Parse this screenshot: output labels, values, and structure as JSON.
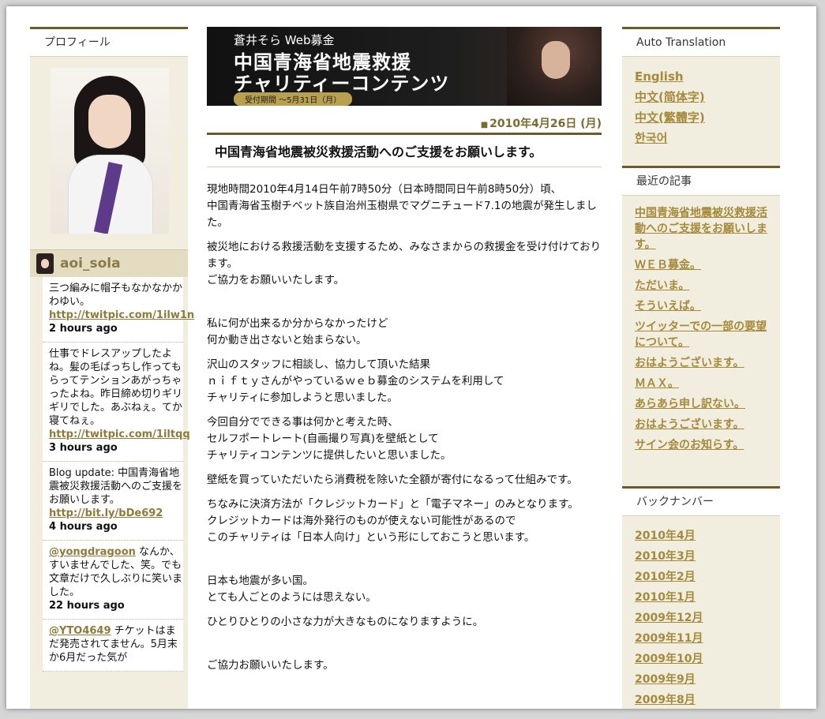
{
  "left_sidebar": {
    "profile_heading": "プロフィール",
    "twitter_username": "aoi_sola",
    "tweets": [
      {
        "text": "三つ編みに帽子もなかなかかわゆい。",
        "link": "http://twitpic.com/1ilw1n",
        "ago": "2 hours ago"
      },
      {
        "text": "仕事でドレスアップしたよね。髪の毛ばっちし作ってもらってテンションあがっちゃったよね。昨日締め切りギリギリでした。あぶねぇ。てか寝てねぇ。",
        "link": "http://twitpic.com/1iltqq",
        "ago": "3 hours ago"
      },
      {
        "text": "Blog update: 中国青海省地震被災救援活動へのご支援をお願いします。",
        "link": "http://bit.ly/bDe692",
        "ago": "4 hours ago"
      },
      {
        "mention": "@yongdragoon",
        "text": " なんか、すいませんでした、笑。でも文章だけで久しぶりに笑いました。",
        "ago": "22 hours ago"
      },
      {
        "mention": "@YTO4649",
        "text": " チケットはまだ発売されてません。5月末か6月だった気が"
      }
    ]
  },
  "banner": {
    "subtitle": "蒼井そら Web募金",
    "title_line1": "中国青海省地震救援",
    "title_line2": "チャリティーコンテンツ",
    "period": "受付期間 ～5月31日（月）"
  },
  "post": {
    "date": "2010年4月26日 (月)",
    "title": "中国青海省地震被災救援活動へのご支援をお願いします。",
    "paragraphs": [
      "現地時間2010年4月14日午前7時50分（日本時間同日午前8時50分）頃、\n中国青海省玉樹チベット族自治州玉樹県でマグニチュード7.1の地震が発生しました。",
      "被災地における救援活動を支援するため、みなさまからの救援金を受け付けております。\nご協力をお願いいたします。",
      "私に何が出来るか分からなかったけど\n何か動き出さないと始まらない。",
      "沢山のスタッフに相談し、協力して頂いた結果\nｎｉｆｔｙさんがやっているｗｅｂ募金のシステムを利用して\nチャリティに参加しようと思いました。",
      "今回自分でできる事は何かと考えた時、\nセルフポートレート(自画撮り写真)を壁紙として\nチャリティコンテンツに提供したいと思いました。",
      "壁紙を買っていただいたら消費税を除いた全額が寄付になるって仕組みです。",
      "ちなみに決済方法が「クレジットカード」と「電子マネー」のみとなります。\nクレジットカードは海外発行のものが使えない可能性があるので\nこのチャリティは「日本人向け」という形にしておこうと思います。",
      "日本も地震が多い国。\nとても人ごとのようには思えない。",
      "ひとりひとりの小さな力が大きなものになりますように。",
      "ご協力お願いいたします。"
    ]
  },
  "right_sidebar": {
    "translation_heading": "Auto Translation",
    "languages": [
      "English",
      "中文(简体字)",
      "中文(繁體字)",
      "한국어"
    ],
    "recent_heading": "最近の記事",
    "recent_posts": [
      "中国青海省地震被災救援活動へのご支援をお願いします。",
      "ＷＥＢ募金。",
      "ただいま。",
      "そういえば。",
      "ツイッターでの一部の要望について。",
      "おはようございます。",
      "ＭＡＸ。",
      "あらあら申し訳ない。",
      "おはようございます。",
      "サイン会のお知らす。"
    ],
    "backnumber_heading": "バックナンバー",
    "backnumbers": [
      "2010年4月",
      "2010年3月",
      "2010年2月",
      "2010年1月",
      "2009年12月",
      "2009年11月",
      "2009年10月",
      "2009年9月",
      "2009年8月"
    ]
  }
}
